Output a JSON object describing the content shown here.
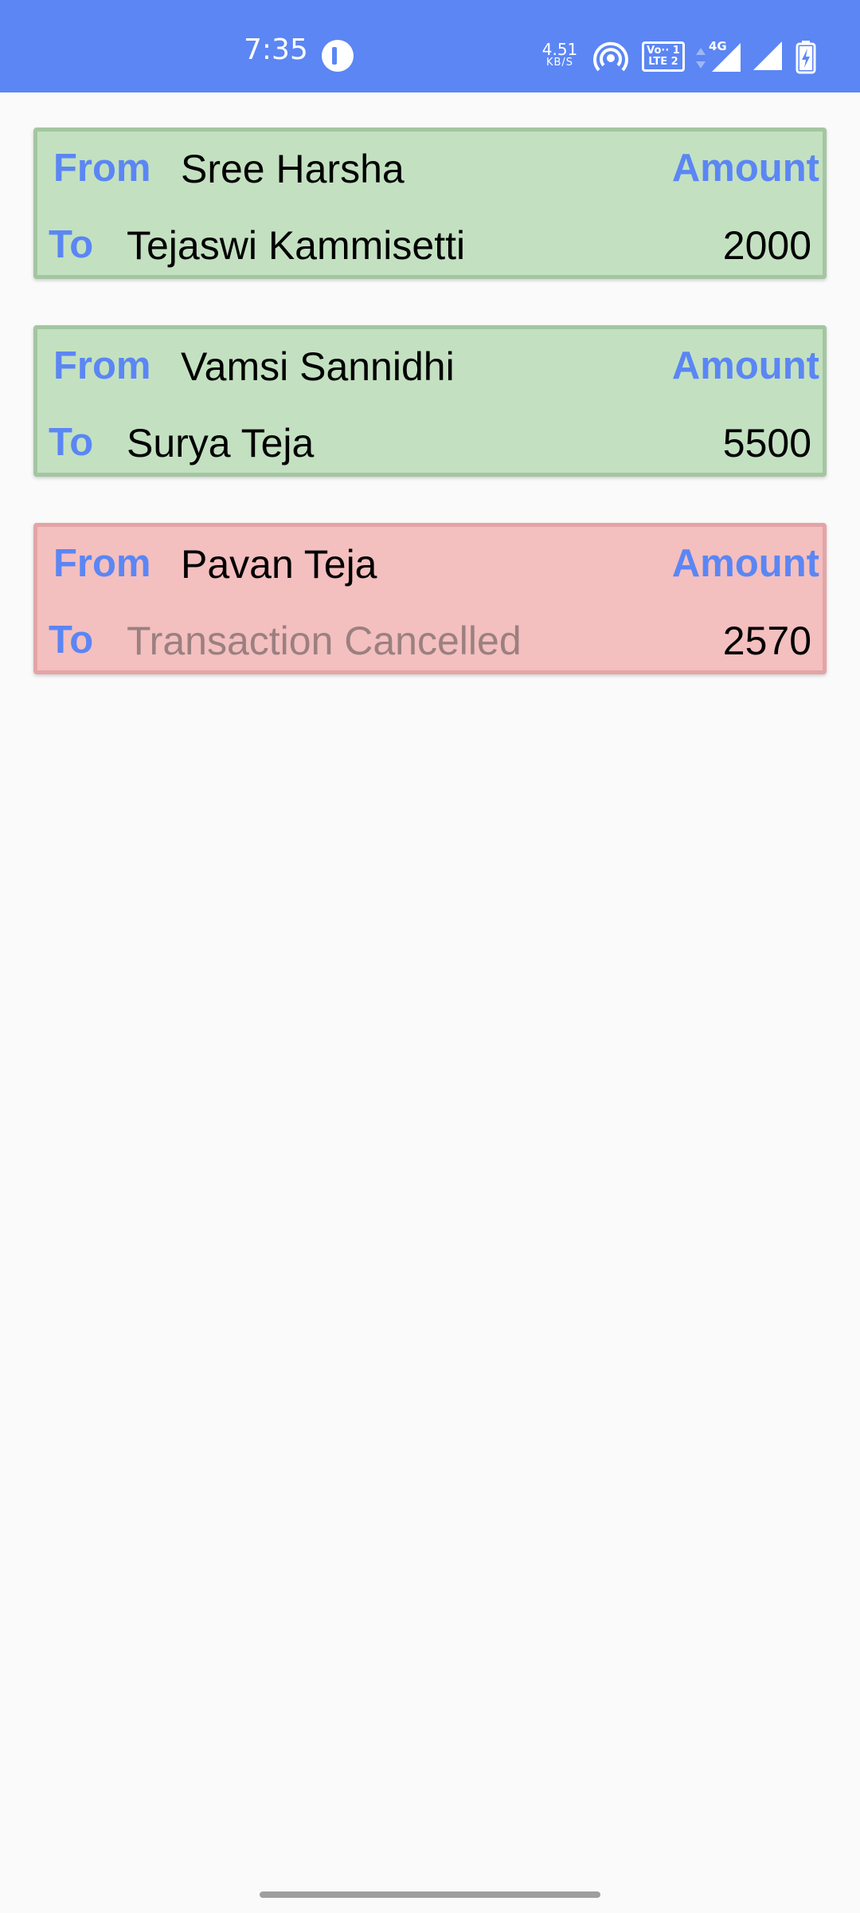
{
  "status_bar": {
    "time": "7:35",
    "net_speed_value": "4.51",
    "net_speed_unit": "KB/S",
    "volte_line1": "Vo·· 1",
    "volte_line2": "LTE 2",
    "network_type": "4G",
    "background_color": "#5b86f4",
    "icons": [
      "app-notification-icon",
      "hotspot-icon",
      "volte-icon",
      "data-arrows-icon",
      "signal-icon",
      "signal-icon",
      "battery-charging-icon"
    ]
  },
  "labels": {
    "from": "From",
    "to": "To",
    "amount": "Amount"
  },
  "transactions": [
    {
      "from": "Sree Harsha",
      "to": "Tejaswi Kammisetti",
      "amount": "2000",
      "status": "success"
    },
    {
      "from": "Vamsi Sannidhi",
      "to": "Surya Teja",
      "amount": "5500",
      "status": "success"
    },
    {
      "from": "Pavan Teja",
      "to": "Transaction Cancelled",
      "amount": "2570",
      "status": "cancelled"
    }
  ],
  "colors": {
    "accent": "#5b86f4",
    "success_bg": "#c3e1c1",
    "success_border": "#a3c6a1",
    "cancel_bg": "#f4bfbf",
    "cancel_border": "#e4a4a6",
    "cancelled_text": "#9b8080"
  }
}
